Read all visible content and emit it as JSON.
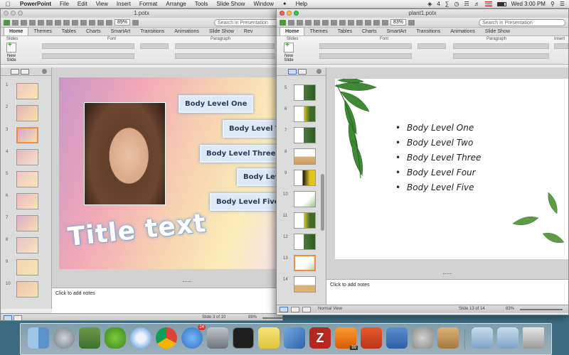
{
  "menubar": {
    "app": "PowerPoint",
    "items": [
      "File",
      "Edit",
      "View",
      "Insert",
      "Format",
      "Arrange",
      "Tools",
      "Slide Show",
      "Window",
      "Help"
    ],
    "clock": "Wed 3:00 PM",
    "badge": "4"
  },
  "win1": {
    "title": "1.potx",
    "zoom": "89%",
    "search_placeholder": "Search in Presentation",
    "tabs": [
      "Home",
      "Themes",
      "Tables",
      "Charts",
      "SmartArt",
      "Transitions",
      "Animations",
      "Slide Show",
      "Rev"
    ],
    "groups": {
      "slides": "Slides",
      "font": "Font",
      "paragraph": "Paragraph"
    },
    "new_slide": "New Slide",
    "slide_numbers": [
      "1",
      "2",
      "3",
      "4",
      "5",
      "6",
      "7",
      "8",
      "9",
      "10"
    ],
    "slide": {
      "bodies": [
        "Body Level One",
        "Body Level Two",
        "Body Level Three",
        "Body Level Four",
        "Body Level Five"
      ],
      "title": "Title text"
    },
    "notes": "Click to add notes",
    "status": {
      "slide": "Slide 3 of 10",
      "zoom": "89%"
    }
  },
  "win2": {
    "title": "plant1.potx",
    "zoom": "83%",
    "search_placeholder": "Search in Presentation",
    "tabs": [
      "Home",
      "Themes",
      "Tables",
      "Charts",
      "SmartArt",
      "Transitions",
      "Animations",
      "Slide Show"
    ],
    "groups": {
      "slides": "Slides",
      "font": "Font",
      "paragraph": "Paragraph",
      "insert": "Insert"
    },
    "new_slide": "New Slide",
    "slide_numbers": [
      "5",
      "6",
      "7",
      "8",
      "9",
      "10",
      "11",
      "12",
      "13",
      "14"
    ],
    "slide": {
      "bullets": [
        "Body Level One",
        "Body Level Two",
        "Body Level Three",
        "Body Level Four",
        "Body Level Five"
      ]
    },
    "notes": "Click to add notes",
    "status": {
      "view": "Normal View",
      "slide": "Slide 13 of 14",
      "zoom": "83%"
    }
  },
  "dock": {
    "items": [
      "Finder",
      "Launchpad",
      "Preview",
      "Adium",
      "Safari",
      "Chrome",
      "App Store",
      "Terminal",
      "Stickies",
      "Xcode",
      "FileZilla",
      "Sublime",
      "Keynote",
      "Keychain",
      "Archive",
      "Documents",
      "Downloads",
      "Trash"
    ],
    "badge_app_store": "24",
    "badge_sublime": "99"
  },
  "colors": {
    "accent": "#ef8d3e",
    "link": "#2a3b56"
  }
}
